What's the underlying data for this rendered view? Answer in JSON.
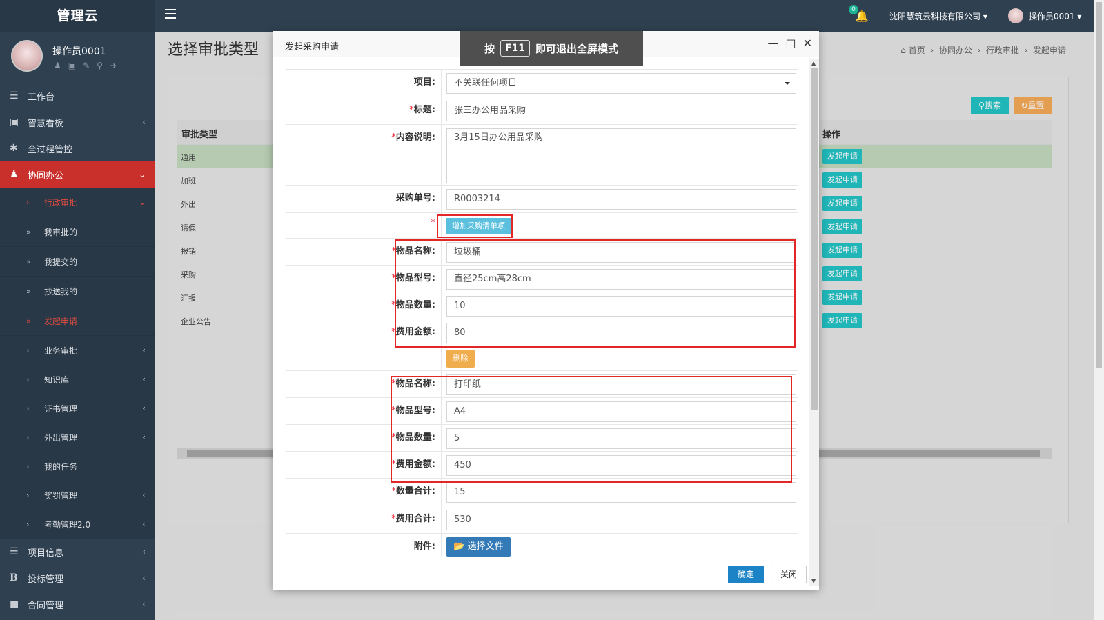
{
  "sidebar": {
    "brand": "管理云",
    "profile_name": "操作员0001",
    "menu": [
      {
        "label": "工作台"
      },
      {
        "label": "智慧看板"
      },
      {
        "label": "全过程管控"
      },
      {
        "label": "协同办公"
      }
    ],
    "submenu": [
      {
        "label": "行政审批"
      },
      {
        "label": "我审批的"
      },
      {
        "label": "我提交的"
      },
      {
        "label": "抄送我的"
      },
      {
        "label": "发起申请"
      },
      {
        "label": "业务审批"
      },
      {
        "label": "知识库"
      },
      {
        "label": "证书管理"
      },
      {
        "label": "外出管理"
      },
      {
        "label": "我的任务"
      },
      {
        "label": "奖罚管理"
      },
      {
        "label": "考勤管理2.0"
      }
    ],
    "bottom": [
      {
        "label": "项目信息"
      },
      {
        "label": "投标管理"
      },
      {
        "label": "合同管理"
      }
    ]
  },
  "topbar": {
    "notification_count": "0",
    "company": "沈阳慧筑云科技有限公司",
    "user": "操作员0001"
  },
  "page": {
    "title": "选择审批类型",
    "breadcrumb": [
      "首页",
      "协同办公",
      "行政审批",
      "发起申请"
    ],
    "search_label": "搜索",
    "reset_label": "重置",
    "col_type": "审批类型",
    "col_action": "操作",
    "rows": [
      "通用",
      "加班",
      "外出",
      "请假",
      "报销",
      "采购",
      "汇报",
      "企业公告"
    ],
    "apply_label": "发起申请"
  },
  "modal": {
    "title": "发起采购申请",
    "f11_pre": "按",
    "f11_key": "F11",
    "f11_post": "即可退出全屏模式",
    "fields": {
      "project_label": "项目:",
      "project_value": "不关联任何项目",
      "title_label": "标题:",
      "title_value": "张三办公用品采购",
      "desc_label": "内容说明:",
      "desc_value": "3月15日办公用品采购",
      "order_label": "采购单号:",
      "order_value": "R0003214",
      "add_item_label": "增加采购清单项",
      "name_label": "物品名称:",
      "model_label": "物品型号:",
      "qty_label": "物品数量:",
      "cost_label": "费用金额:",
      "delete_label": "删除",
      "qty_total_label": "数量合计:",
      "qty_total_value": "15",
      "cost_total_label": "费用合计:",
      "cost_total_value": "530",
      "attach_label": "附件:",
      "choose_file_label": "选择文件"
    },
    "items": [
      {
        "name": "垃圾桶",
        "model": "直径25cm高28cm",
        "qty": "10",
        "cost": "80"
      },
      {
        "name": "打印纸",
        "model": "A4",
        "qty": "5",
        "cost": "450"
      }
    ],
    "ok_label": "确定",
    "close_label": "关闭"
  }
}
